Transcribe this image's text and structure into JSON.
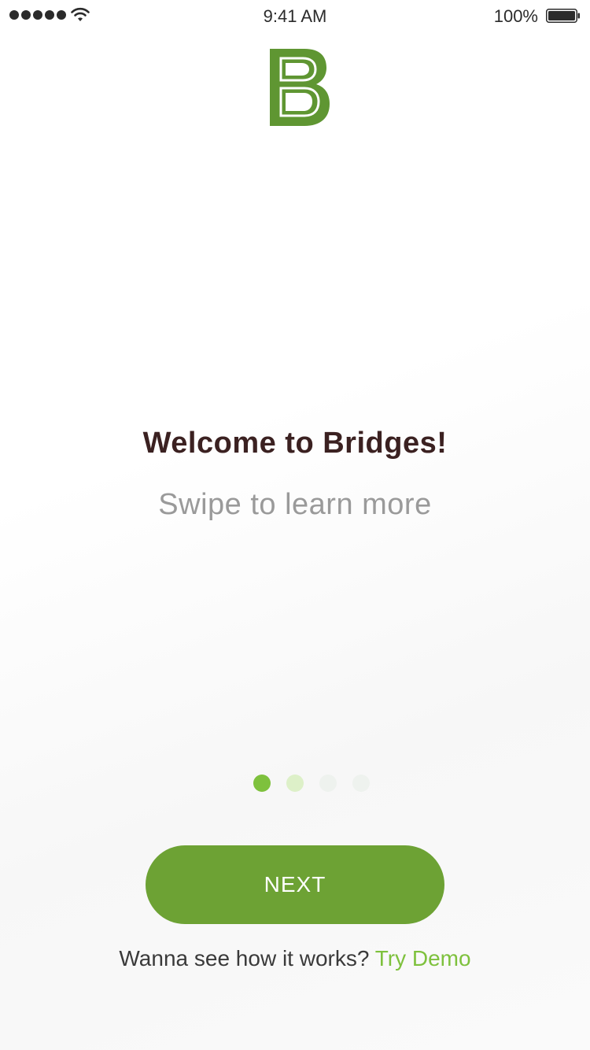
{
  "status_bar": {
    "time": "9:41 AM",
    "battery_percent": "100%",
    "signal_icon": "signal-dots-icon",
    "wifi_icon": "wifi-icon",
    "battery_icon": "battery-full-icon",
    "text_color": "#2b2b2b"
  },
  "logo": {
    "letter": "B",
    "icon": "bridges-logo-icon",
    "color": "#5f9632"
  },
  "welcome": {
    "title": "Welcome to Bridges!",
    "subtitle": "Swipe to learn more"
  },
  "pagination": {
    "total": 4,
    "active_index": 0,
    "active_color": "#7ec13d",
    "next_color": "#ddf0c8",
    "inactive_color": "#eef2ee"
  },
  "next_button": {
    "label": "NEXT",
    "color": "#6da234"
  },
  "footer": {
    "prompt": "Wanna see how it works?",
    "link_label": "Try Demo",
    "link_color": "#7ec13d"
  }
}
